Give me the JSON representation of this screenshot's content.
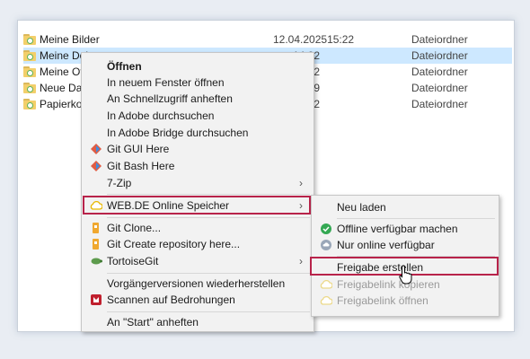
{
  "files": [
    {
      "name": "Meine Bilder",
      "date": "12.04.2025",
      "time": "15:22",
      "type": "Dateiordner"
    },
    {
      "name": "Meine Dok",
      "date": "",
      "time": "14:02",
      "type": "Dateiordner"
    },
    {
      "name": "Meine Off",
      "date": "",
      "time": "15:12",
      "type": "Dateiordner"
    },
    {
      "name": "Neue Date",
      "date": "",
      "time": "10:19",
      "type": "Dateiordner"
    },
    {
      "name": "Papierkorb",
      "date": "",
      "time": "14:02",
      "type": "Dateiordner"
    }
  ],
  "context_menu": {
    "open": "Öffnen",
    "new_window": "In neuem Fenster öffnen",
    "pin_quick": "An Schnellzugriff anheften",
    "adobe_search": "In Adobe durchsuchen",
    "bridge_search": "In Adobe Bridge durchsuchen",
    "git_gui": "Git GUI Here",
    "git_bash": "Git Bash Here",
    "zip": "7-Zip",
    "webde": "WEB.DE Online Speicher",
    "git_clone": "Git Clone...",
    "git_create": "Git Create repository here...",
    "tortoise": "TortoiseGit",
    "prev_versions": "Vorgängerversionen wiederherstellen",
    "scan": "Scannen auf Bedrohungen",
    "pin_start": "An \"Start\" anheften"
  },
  "submenu": {
    "reload": "Neu laden",
    "offline": "Offline verfügbar machen",
    "online_only": "Nur online verfügbar",
    "create_share": "Freigabe erstellen",
    "copy_link": "Freigabelink kopieren",
    "open_link": "Freigabelink öffnen"
  },
  "colors": {
    "highlight": "#b8234a",
    "selection": "#cde8ff"
  }
}
